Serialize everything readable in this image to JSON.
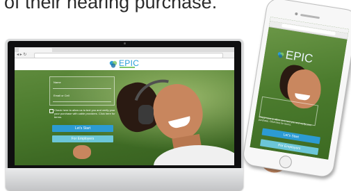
{
  "headline": "of their hearing purchase.",
  "desktop": {
    "brand": "EPIC",
    "form": {
      "name_label": "Name",
      "email_label": "Email or Cell"
    },
    "consent": "Check here to allow us to text you and verify your your purchase with cable providers. Click here for terms.",
    "buttons": {
      "start": "Let's Start",
      "employers": "For Employers"
    }
  },
  "mobile": {
    "brand": "EPIC",
    "consent": "Check here to allow us to text you and verify your purchase. Click here for terms.",
    "buttons": {
      "start": "Let's Start",
      "employers": "For Employers"
    }
  },
  "colors": {
    "brand_blue": "#2c9bd3",
    "secondary_button": "#6cc6d8",
    "logo_green": "#7fc96a"
  }
}
